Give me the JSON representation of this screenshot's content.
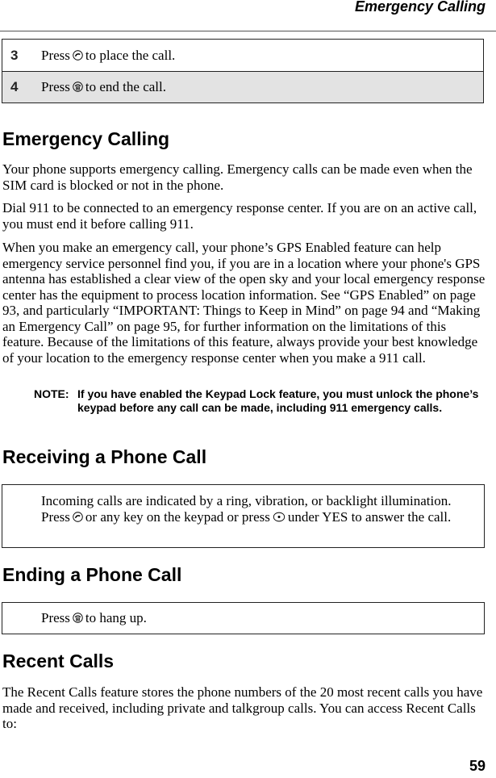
{
  "header": {
    "running_title": "Emergency Calling"
  },
  "steps": [
    {
      "number": "3",
      "prefix": "Press",
      "icon": "send-key-icon",
      "suffix": "to place the call.",
      "shaded": false
    },
    {
      "number": "4",
      "prefix": "Press",
      "icon": "end-key-icon",
      "suffix": "to end the call.",
      "shaded": true
    }
  ],
  "sections": {
    "emergency": {
      "title": "Emergency Calling",
      "paragraphs": [
        "Your phone supports emergency calling. Emergency calls can be made even when the SIM card is blocked or not in the phone.",
        "Dial 911 to be connected to an emergency response center. If you are on an active call, you must end it before calling 911.",
        "When you make an emergency call, your phone’s GPS Enabled feature can help emergency service personnel find you, if you are in a location where your phone's GPS antenna has established a clear view of the open sky and your local emergency response center has the equipment to process location information. See “GPS Enabled” on page 93, and particularly “IMPORTANT: Things to Keep in Mind” on page 94 and “Making an Emergency Call” on page 95, for further information on the limitations of this feature. Because of the limitations of this feature, always provide your best knowledge of your location to the emergency response center when you make a 911 call."
      ],
      "note": {
        "label": "NOTE:",
        "text": "If you have enabled the Keypad Lock feature, you must unlock the phone’s keypad before any call can be made, including 911 emergency calls."
      }
    },
    "receiving": {
      "title": "Receiving a Phone Call",
      "box": {
        "part1": "Incoming calls are indicated by a ring, vibration, or backlight illumination. Press",
        "icon1": "send-key-icon",
        "part2": "or any key on the keypad or press",
        "icon2": "center-select-key-icon",
        "part3": "under YES to answer the call."
      }
    },
    "ending": {
      "title": "Ending a Phone Call",
      "box": {
        "prefix": "Press",
        "icon": "end-key-icon",
        "suffix": "to hang up."
      }
    },
    "recent": {
      "title": "Recent Calls",
      "paragraph": "The Recent Calls feature stores the phone numbers of the 20 most recent calls you have made and received, including private and talkgroup calls. You can access Recent Calls to:"
    }
  },
  "footer": {
    "page_number": "59"
  }
}
